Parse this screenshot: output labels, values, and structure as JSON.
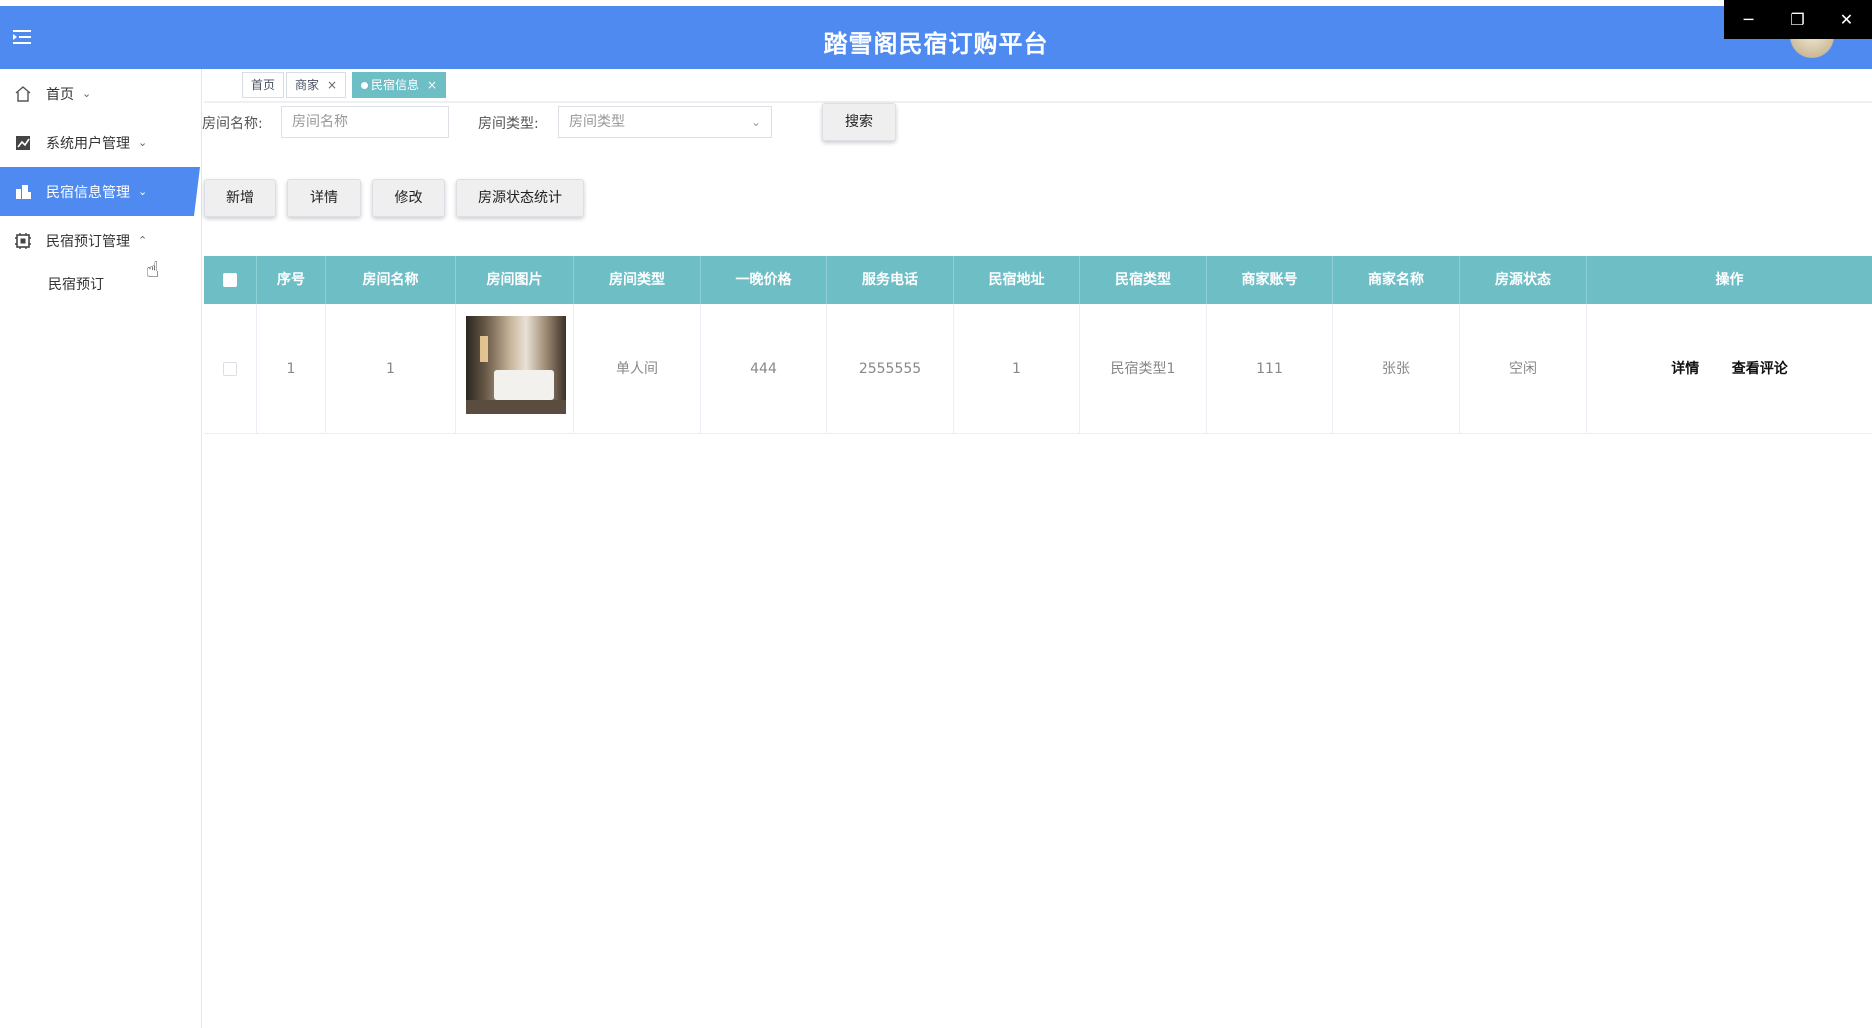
{
  "header": {
    "title": "踏雪阁民宿订购平台",
    "user_name": "",
    "menu_icon": "menu-fold-icon",
    "window_controls": {
      "minimize": "─",
      "restore": "❐",
      "close": "✕"
    }
  },
  "sidebar": {
    "items": [
      {
        "label": "首页",
        "icon": "home-icon",
        "chevron": "⌄"
      },
      {
        "label": "系统用户管理",
        "icon": "chart-icon",
        "chevron": "⌄"
      },
      {
        "label": "民宿信息管理",
        "icon": "building-icon",
        "chevron": "⌄",
        "active": true
      },
      {
        "label": "民宿预订管理",
        "icon": "gear-icon",
        "chevron": "⌃"
      }
    ],
    "sub_items": [
      {
        "label": "民宿预订"
      }
    ]
  },
  "tabs": [
    {
      "label": "首页",
      "closable": false
    },
    {
      "label": "商家",
      "closable": true,
      "close": "×"
    },
    {
      "label": "民宿信息",
      "closable": true,
      "close": "×",
      "active": true
    }
  ],
  "search": {
    "room_name_label": "房间名称:",
    "room_name_placeholder": "房间名称",
    "room_type_label": "房间类型:",
    "room_type_placeholder": "房间类型",
    "search_button": "搜索"
  },
  "actions": {
    "add": "新增",
    "detail": "详情",
    "edit": "修改",
    "stats": "房源状态统计"
  },
  "table": {
    "columns": [
      "序号",
      "房间名称",
      "房间图片",
      "房间类型",
      "一晚价格",
      "服务电话",
      "民宿地址",
      "民宿类型",
      "商家账号",
      "商家名称",
      "房源状态",
      "操作"
    ],
    "rows": [
      {
        "index": "1",
        "room_name": "1",
        "room_type": "单人间",
        "price": "444",
        "phone": "2555555",
        "address": "1",
        "homestay_type": "民宿类型1",
        "merchant_account": "111",
        "merchant_name": "张张",
        "status": "空闲",
        "op_detail": "详情",
        "op_reviews": "查看评论"
      }
    ]
  },
  "colors": {
    "primary": "#4e8af0",
    "table_header": "#6ebec6"
  }
}
